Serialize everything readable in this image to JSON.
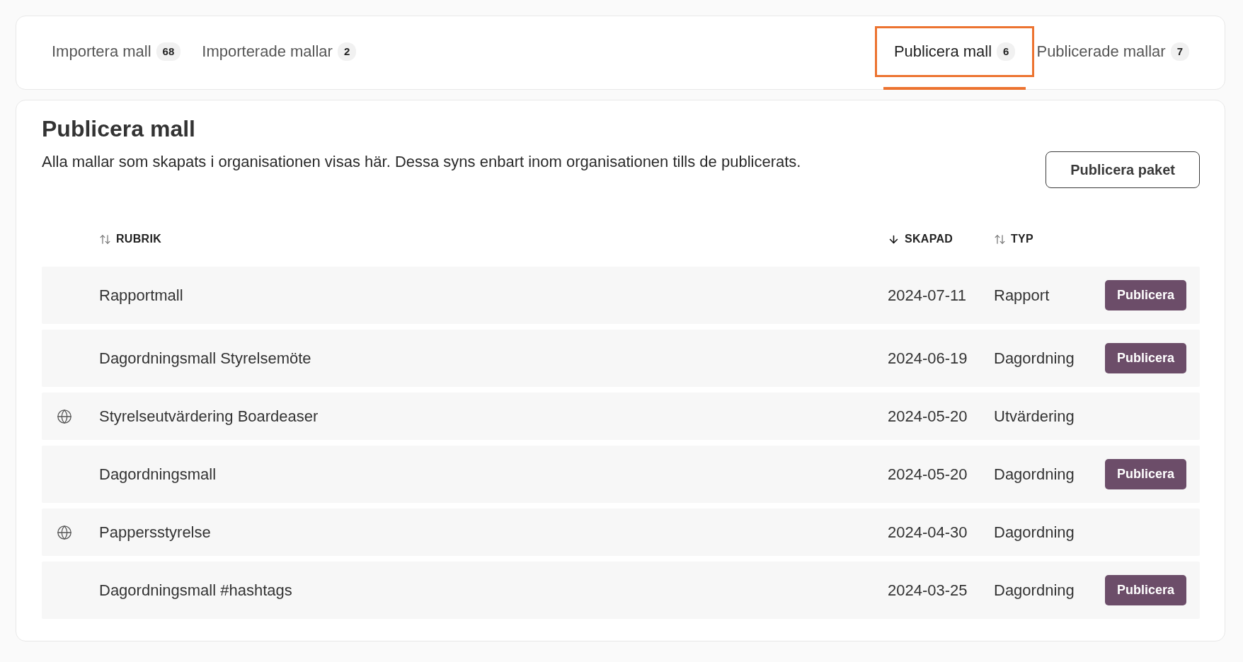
{
  "tabs": {
    "start": [
      {
        "label": "Importera mall",
        "count": "68",
        "selected": false,
        "focused": false
      },
      {
        "label": "Importerade mallar",
        "count": "2",
        "selected": false,
        "focused": false
      }
    ],
    "end": [
      {
        "label": "Publicera mall",
        "count": "6",
        "selected": true,
        "focused": true
      },
      {
        "label": "Publicerade mallar",
        "count": "7",
        "selected": false,
        "focused": false
      }
    ]
  },
  "panel": {
    "title": "Publicera mall",
    "description": "Alla mallar som skapats i organisationen visas här. Dessa syns enbart inom organisationen tills de publicerats.",
    "button": "Publicera paket"
  },
  "table": {
    "columns": [
      {
        "label": "RUBRIK",
        "kind": "unsorted"
      },
      {
        "label": "SKAPAD",
        "kind": "descending"
      },
      {
        "label": "TYP",
        "kind": "unsorted"
      }
    ],
    "rows": [
      {
        "public": false,
        "title": "Rapportmall",
        "created": "2024-07-11",
        "type": "Rapport",
        "button": "Publicera"
      },
      {
        "public": false,
        "title": "Dagordningsmall Styrelsemöte",
        "created": "2024-06-19",
        "type": "Dagordning",
        "button": "Publicera"
      },
      {
        "public": true,
        "title": "Styrelseutvärdering Boardeaser",
        "created": "2024-05-20",
        "type": "Utvärdering"
      },
      {
        "public": false,
        "title": "Dagordningsmall",
        "created": "2024-05-20",
        "type": "Dagordning",
        "button": "Publicera"
      },
      {
        "public": true,
        "title": "Pappersstyrelse",
        "created": "2024-04-30",
        "type": "Dagordning"
      },
      {
        "public": false,
        "title": "Dagordningsmall #hashtags",
        "created": "2024-03-25",
        "type": "Dagordning",
        "button": "Publicera"
      }
    ]
  }
}
